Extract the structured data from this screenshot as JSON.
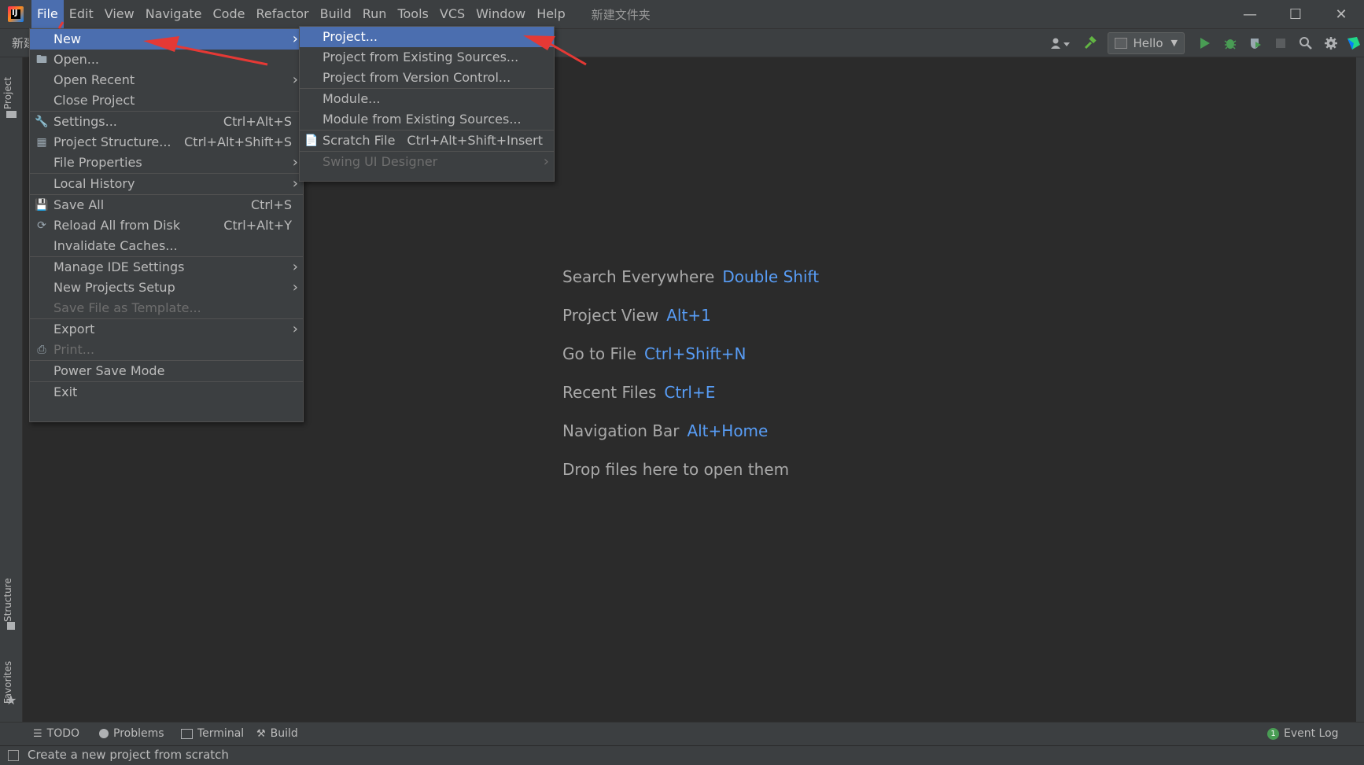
{
  "titlebar": {
    "app_icon_letter": "IJ",
    "menus": [
      "File",
      "Edit",
      "View",
      "Navigate",
      "Code",
      "Refactor",
      "Build",
      "Run",
      "Tools",
      "VCS",
      "Window",
      "Help"
    ],
    "window_title": "新建文件夹",
    "controls": [
      "—",
      "☐",
      "✕"
    ]
  },
  "toolbar": {
    "breadcrumb": "新建",
    "run_config": "Hello",
    "icons": [
      "user-icon",
      "hammer-icon",
      "run-icon",
      "debug-icon",
      "coverage-icon",
      "stop-icon",
      "search-icon",
      "gear-icon",
      "logo-icon"
    ]
  },
  "left_tabs": {
    "project": "Project",
    "structure": "Structure",
    "favorites": "Favorites"
  },
  "file_menu": {
    "items": [
      {
        "label": "New",
        "arrow": true,
        "selected": true
      },
      {
        "label": "Open...",
        "icon": "folder-icon"
      },
      {
        "label": "Open Recent",
        "arrow": true
      },
      {
        "label": "Close Project"
      },
      {
        "sep": true
      },
      {
        "label": "Settings...",
        "shortcut": "Ctrl+Alt+S",
        "icon": "wrench-icon"
      },
      {
        "label": "Project Structure...",
        "shortcut": "Ctrl+Alt+Shift+S",
        "icon": "project-structure-icon"
      },
      {
        "label": "File Properties",
        "arrow": true
      },
      {
        "sep": true
      },
      {
        "label": "Local History",
        "arrow": true
      },
      {
        "sep": true
      },
      {
        "label": "Save All",
        "shortcut": "Ctrl+S",
        "icon": "save-icon"
      },
      {
        "label": "Reload All from Disk",
        "shortcut": "Ctrl+Alt+Y",
        "icon": "reload-icon"
      },
      {
        "label": "Invalidate Caches..."
      },
      {
        "sep": true
      },
      {
        "label": "Manage IDE Settings",
        "arrow": true
      },
      {
        "label": "New Projects Setup",
        "arrow": true
      },
      {
        "label": "Save File as Template...",
        "disabled": true
      },
      {
        "sep": true
      },
      {
        "label": "Export",
        "arrow": true
      },
      {
        "label": "Print...",
        "disabled": true,
        "icon": "print-icon"
      },
      {
        "sep": true
      },
      {
        "label": "Power Save Mode"
      },
      {
        "sep": true
      },
      {
        "label": "Exit"
      }
    ]
  },
  "new_menu": {
    "items": [
      {
        "label": "Project...",
        "selected": true
      },
      {
        "label": "Project from Existing Sources..."
      },
      {
        "label": "Project from Version Control..."
      },
      {
        "sep": true
      },
      {
        "label": "Module..."
      },
      {
        "label": "Module from Existing Sources..."
      },
      {
        "sep": true
      },
      {
        "label": "Scratch File",
        "shortcut": "Ctrl+Alt+Shift+Insert",
        "icon": "scratch-file-icon"
      },
      {
        "sep": true
      },
      {
        "label": "Swing UI Designer",
        "disabled": true,
        "arrow": true
      }
    ]
  },
  "welcome": [
    {
      "label": "Search Everywhere",
      "key": "Double Shift"
    },
    {
      "label": "Project View",
      "key": "Alt+1"
    },
    {
      "label": "Go to File",
      "key": "Ctrl+Shift+N"
    },
    {
      "label": "Recent Files",
      "key": "Ctrl+E"
    },
    {
      "label": "Navigation Bar",
      "key": "Alt+Home"
    },
    {
      "label": "Drop files here to open them",
      "key": ""
    }
  ],
  "bottom_tools": {
    "todo": "TODO",
    "problems": "Problems",
    "terminal": "Terminal",
    "build": "Build",
    "event_log": "Event Log",
    "event_count": "1"
  },
  "status": "Create a new project from scratch",
  "colors": {
    "accent": "#4b6eaf",
    "key": "#589df6",
    "annotation": "#e53935"
  }
}
